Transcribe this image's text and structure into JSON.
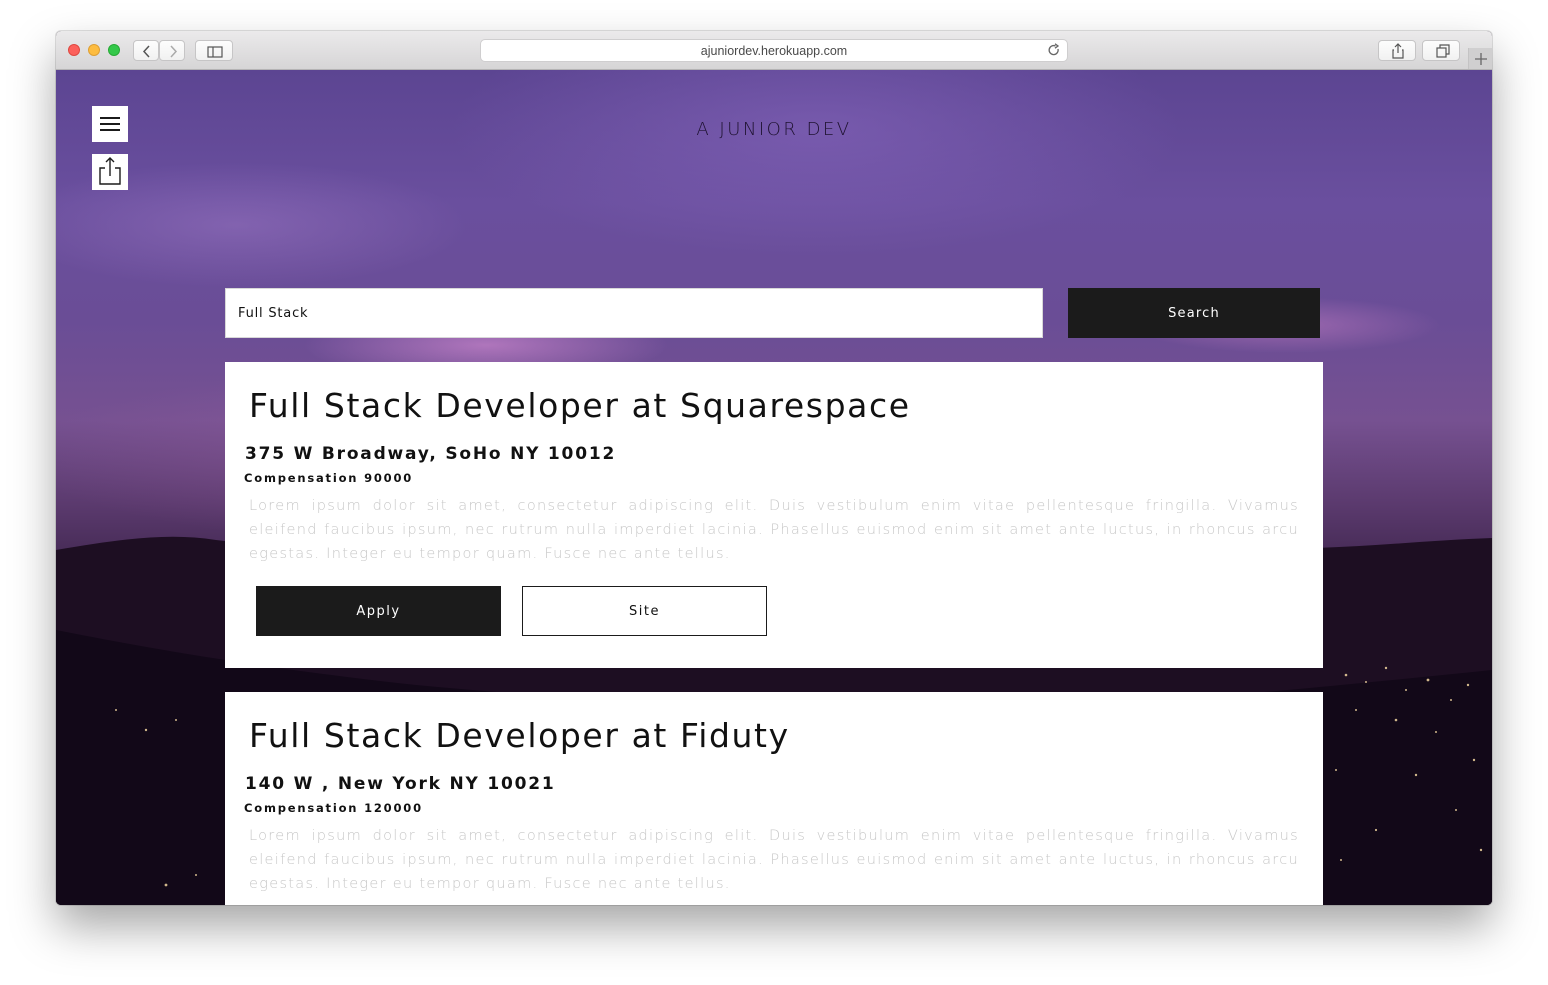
{
  "browser": {
    "url": "ajuniordev.herokuapp.com"
  },
  "header": {
    "site_title": "A JUNIOR DEV"
  },
  "search": {
    "value": "Full Stack",
    "button_label": "Search"
  },
  "jobs": [
    {
      "title": "Full Stack Developer at Squarespace",
      "address": "375 W Broadway, SoHo NY 10012",
      "compensation": "Compensation 90000",
      "description": "Lorem ipsum dolor sit amet, consectetur adipiscing elit. Duis vestibulum enim vitae pellentesque fringilla. Vivamus eleifend faucibus ipsum, nec rutrum nulla imperdiet lacinia. Phasellus euismod enim sit amet ante luctus, in rhoncus arcu egestas. Integer eu tempor quam. Fusce nec ante tellus.",
      "apply_label": "Apply",
      "site_label": "Site"
    },
    {
      "title": "Full Stack Developer at Fiduty",
      "address": "140 W , New York NY 10021",
      "compensation": "Compensation 120000",
      "description": "Lorem ipsum dolor sit amet, consectetur adipiscing elit. Duis vestibulum enim vitae pellentesque fringilla. Vivamus eleifend faucibus ipsum, nec rutrum nulla imperdiet lacinia. Phasellus euismod enim sit amet ante luctus, in rhoncus arcu egestas. Integer eu tempor quam. Fusce nec ante tellus."
    }
  ]
}
